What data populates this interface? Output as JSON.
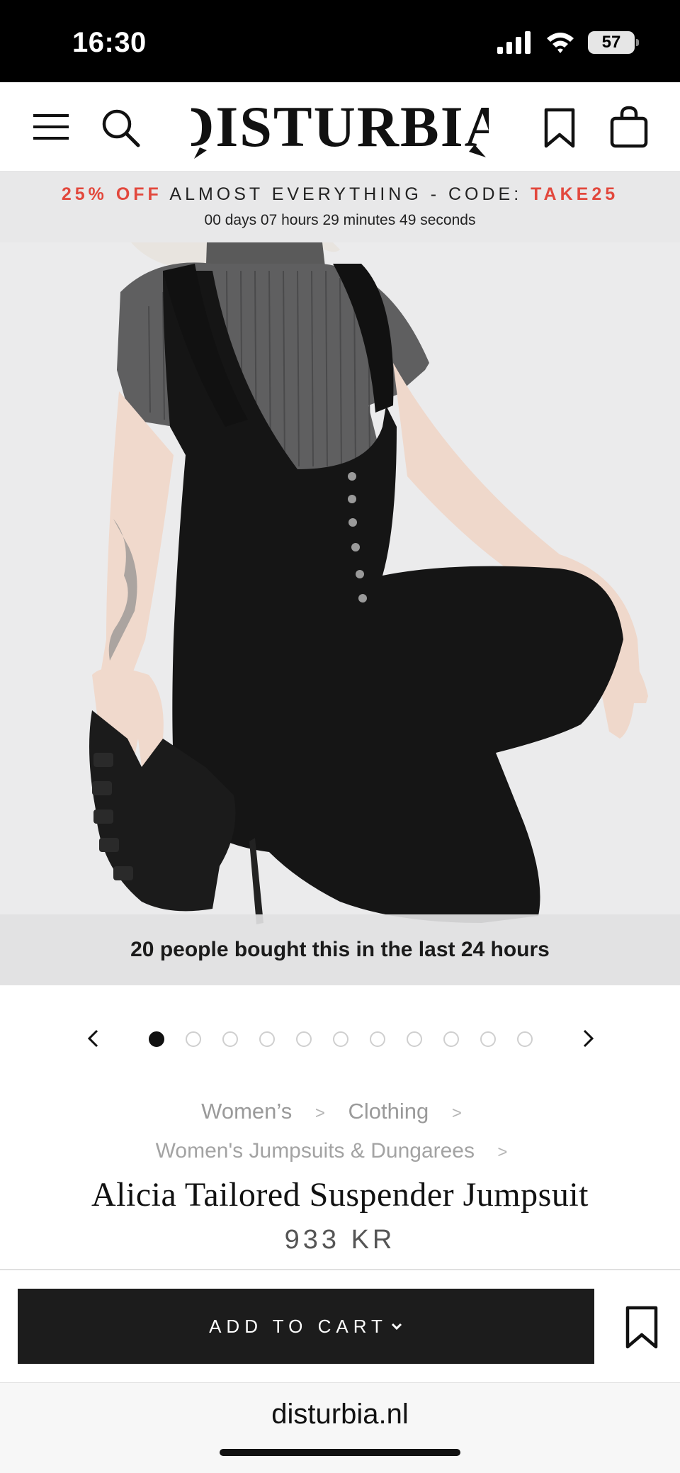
{
  "status_bar": {
    "time": "16:30",
    "battery": "57"
  },
  "header": {
    "logo_text": "DISTURBIA"
  },
  "promo": {
    "discount": "25% OFF",
    "message": "ALMOST EVERYTHING - CODE:",
    "code": "TAKE25",
    "countdown": "00 days 07 hours 29 minutes 49 seconds"
  },
  "hero": {
    "social_proof": "20 people bought this in the last 24 hours"
  },
  "carousel": {
    "total_images": 11,
    "active_index": 0
  },
  "breadcrumbs": {
    "level1": "Women’s",
    "level2": "Clothing",
    "level3": "Women's Jumpsuits & Dungarees",
    "separator": ">"
  },
  "product": {
    "title": "Alicia Tailored Suspender Jumpsuit",
    "price": "933 KR"
  },
  "actions": {
    "add_to_cart": "ADD TO CART"
  },
  "browser": {
    "url": "disturbia.nl"
  },
  "colors": {
    "accent_red": "#e2483d",
    "button_bg": "#1c1c1c",
    "banner_bg": "#e8e8e9"
  }
}
